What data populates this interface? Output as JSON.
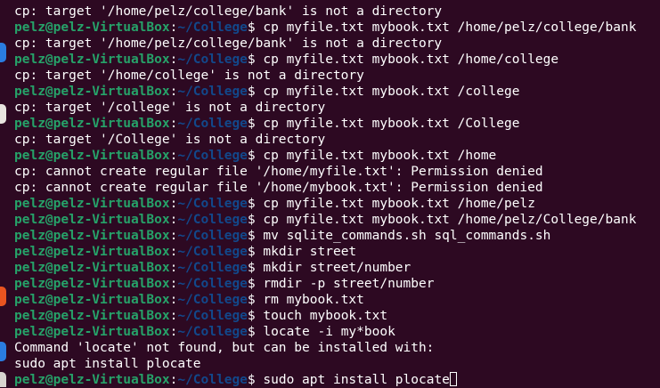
{
  "colors": {
    "background": "#2d0922",
    "prompt_user": "#26a269",
    "prompt_path": "#12488b",
    "text": "#ffffff"
  },
  "prompt": {
    "user_host": "pelz@pelz-VirtualBox",
    "separator": ":",
    "path": "~/College",
    "symbol": "$ "
  },
  "terminal": {
    "lines": [
      {
        "type": "output",
        "text": "cp: target '/home/pelz/college/bank' is not a directory"
      },
      {
        "type": "command",
        "text": "cp myfile.txt mybook.txt /home/pelz/college/bank"
      },
      {
        "type": "output",
        "text": "cp: target '/home/pelz/college/bank' is not a directory"
      },
      {
        "type": "command",
        "text": "cp myfile.txt mybook.txt /home/college"
      },
      {
        "type": "output",
        "text": "cp: target '/home/college' is not a directory"
      },
      {
        "type": "command",
        "text": "cp myfile.txt mybook.txt /college"
      },
      {
        "type": "output",
        "text": "cp: target '/college' is not a directory"
      },
      {
        "type": "command",
        "text": "cp myfile.txt mybook.txt /College"
      },
      {
        "type": "output",
        "text": "cp: target '/College' is not a directory"
      },
      {
        "type": "command",
        "text": "cp myfile.txt mybook.txt /home"
      },
      {
        "type": "output",
        "text": "cp: cannot create regular file '/home/myfile.txt': Permission denied"
      },
      {
        "type": "output",
        "text": "cp: cannot create regular file '/home/mybook.txt': Permission denied"
      },
      {
        "type": "command",
        "text": "cp myfile.txt mybook.txt /home/pelz"
      },
      {
        "type": "command",
        "text": "cp myfile.txt mybook.txt /home/pelz/College/bank"
      },
      {
        "type": "command",
        "text": "mv sqlite_commands.sh sql_commands.sh"
      },
      {
        "type": "command",
        "text": "mkdir street"
      },
      {
        "type": "command",
        "text": "mkdir street/number"
      },
      {
        "type": "command",
        "text": "rmdir -p street/number"
      },
      {
        "type": "command",
        "text": "rm mybook.txt"
      },
      {
        "type": "command",
        "text": "touch mybook.txt"
      },
      {
        "type": "command",
        "text": "locate -i my*book"
      },
      {
        "type": "output",
        "text": "Command 'locate' not found, but can be installed with:"
      },
      {
        "type": "output",
        "text": "sudo apt install plocate"
      },
      {
        "type": "input",
        "text": "sudo apt install plocate"
      }
    ]
  },
  "dock": {
    "icons": [
      {
        "name": "blue-app-icon",
        "color": "#2a7de1"
      },
      {
        "name": "files-app-icon",
        "color": "#e8e4df"
      },
      {
        "name": "software-app-icon",
        "color": "#e95420"
      },
      {
        "name": "help-app-icon",
        "color": "#2a7de1"
      },
      {
        "name": "grid-app-icon",
        "color": "#d8d4cf"
      }
    ]
  }
}
